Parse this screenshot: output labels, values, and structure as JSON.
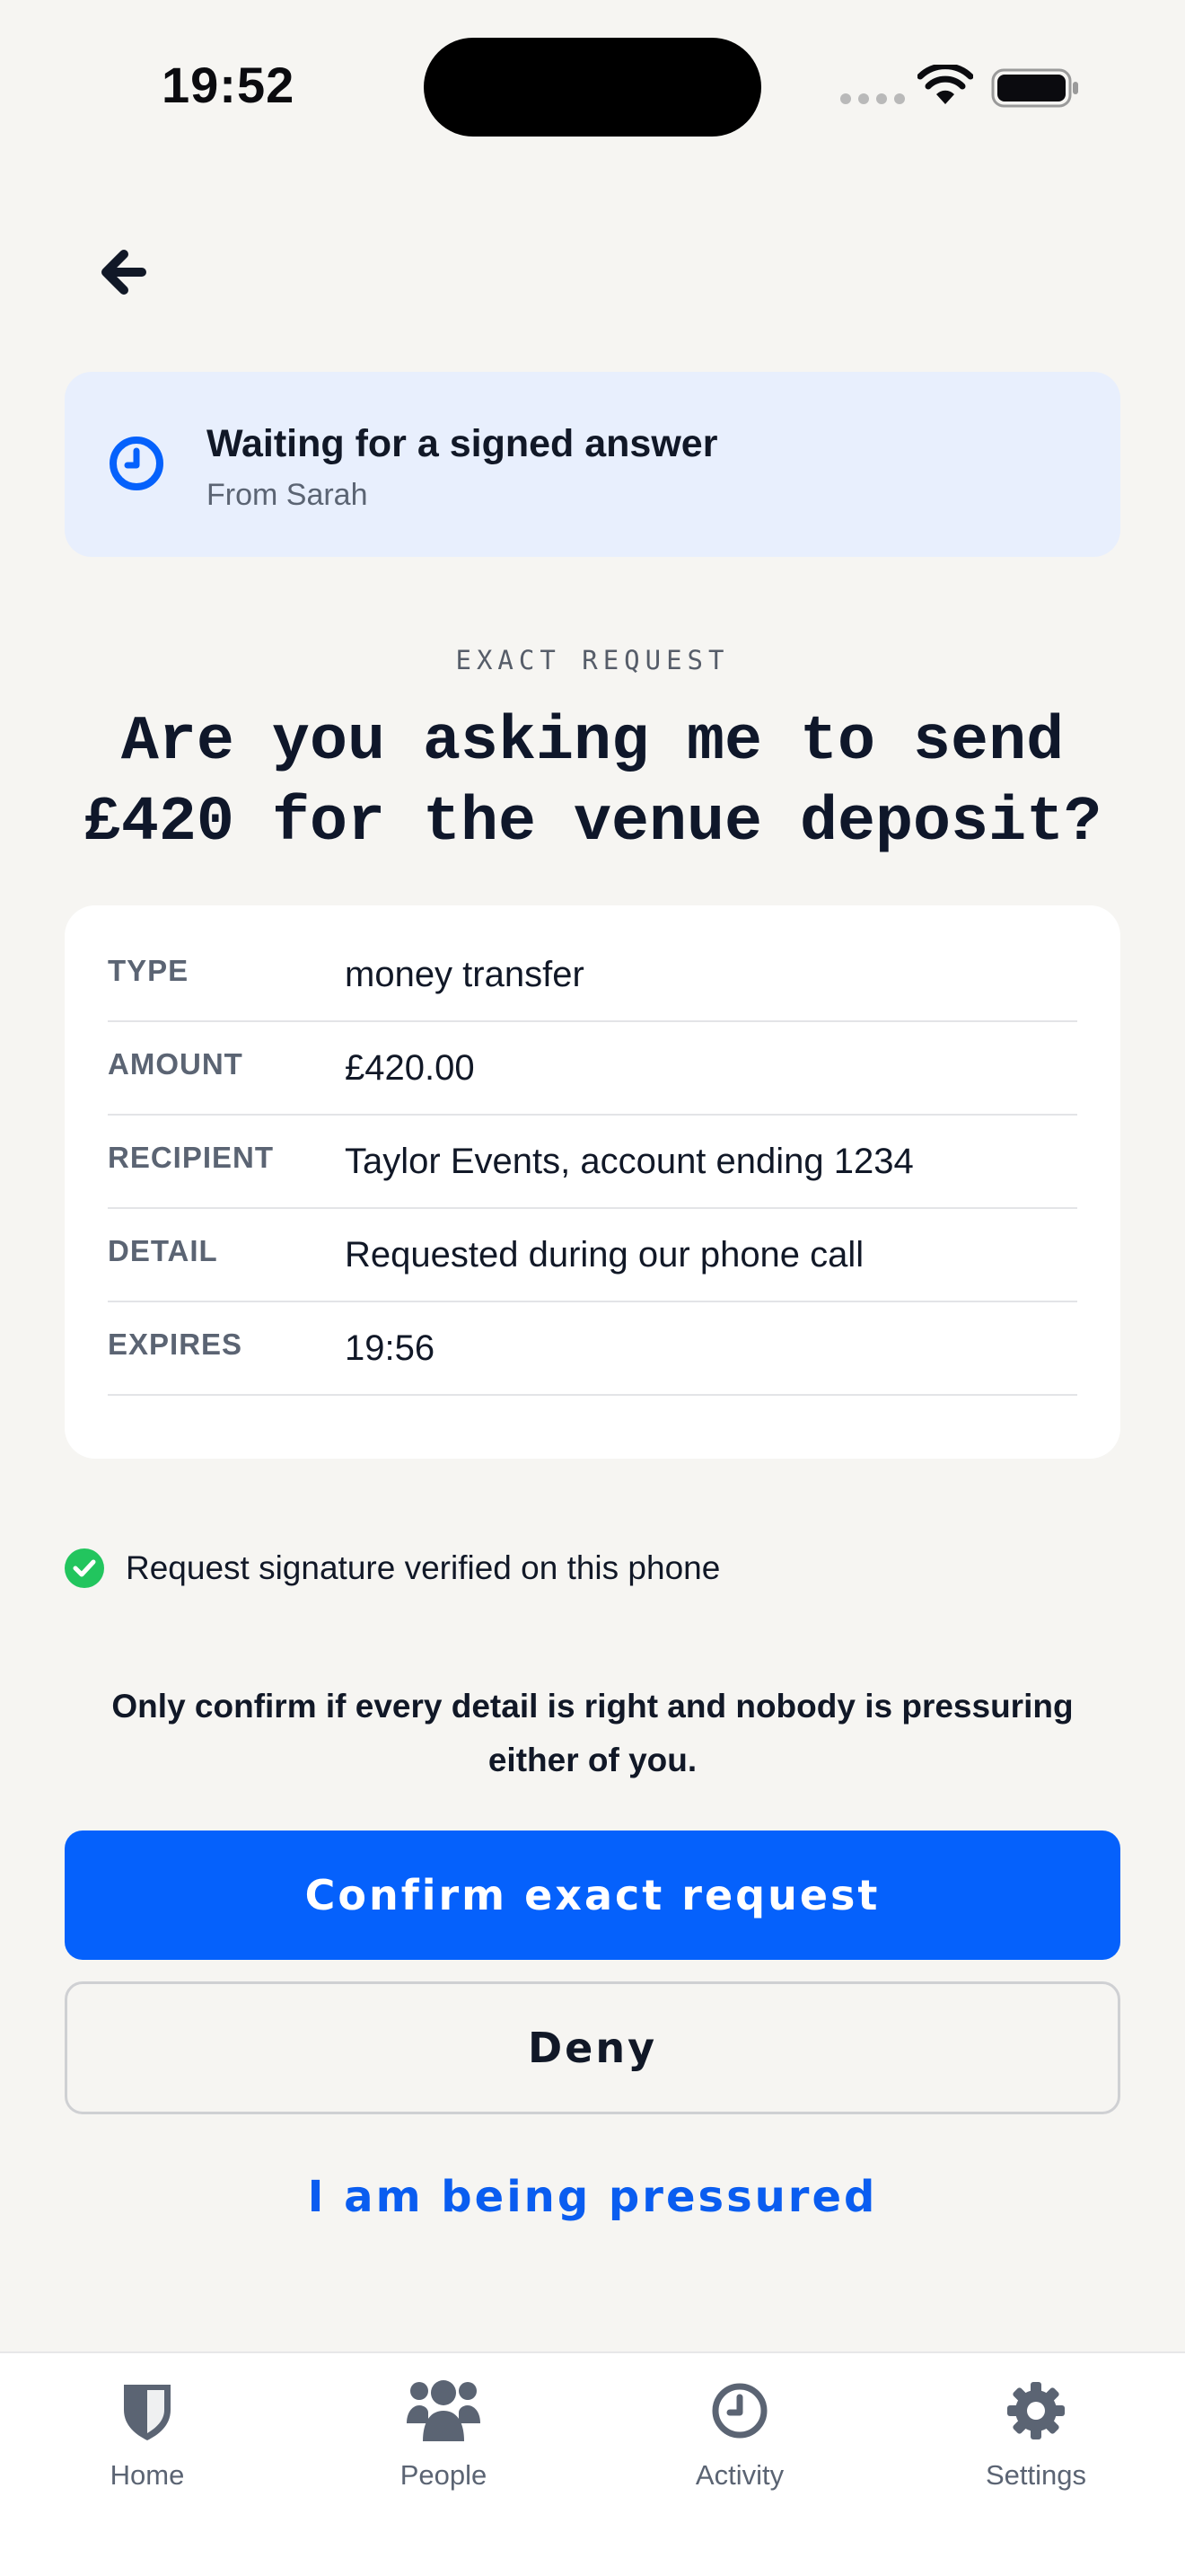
{
  "status_bar": {
    "time": "19:52"
  },
  "banner": {
    "title": "Waiting for a signed answer",
    "subtitle": "From Sarah"
  },
  "request": {
    "eyebrow": "EXACT REQUEST",
    "question": "Are you asking me to send £420 for the venue deposit?"
  },
  "details": [
    {
      "label": "TYPE",
      "value": "money transfer"
    },
    {
      "label": "AMOUNT",
      "value": "£420.00"
    },
    {
      "label": "RECIPIENT",
      "value": "Taylor Events, account ending 1234"
    },
    {
      "label": "DETAIL",
      "value": "Requested during our phone call"
    },
    {
      "label": "EXPIRES",
      "value": "19:56"
    }
  ],
  "verified_text": "Request signature verified on this phone",
  "warning_text": "Only confirm if every detail is right and nobody is pressuring either of you.",
  "actions": {
    "confirm_label": "Confirm exact request",
    "deny_label": "Deny",
    "pressured_label": "I am being pressured"
  },
  "tabs": [
    {
      "label": "Home",
      "icon": "shield-icon"
    },
    {
      "label": "People",
      "icon": "people-icon"
    },
    {
      "label": "Activity",
      "icon": "clock-icon"
    },
    {
      "label": "Settings",
      "icon": "gear-icon"
    }
  ],
  "colors": {
    "accent": "#0561fc",
    "banner_bg": "#e8effd",
    "success": "#22c55e",
    "background": "#f6f5f2"
  }
}
